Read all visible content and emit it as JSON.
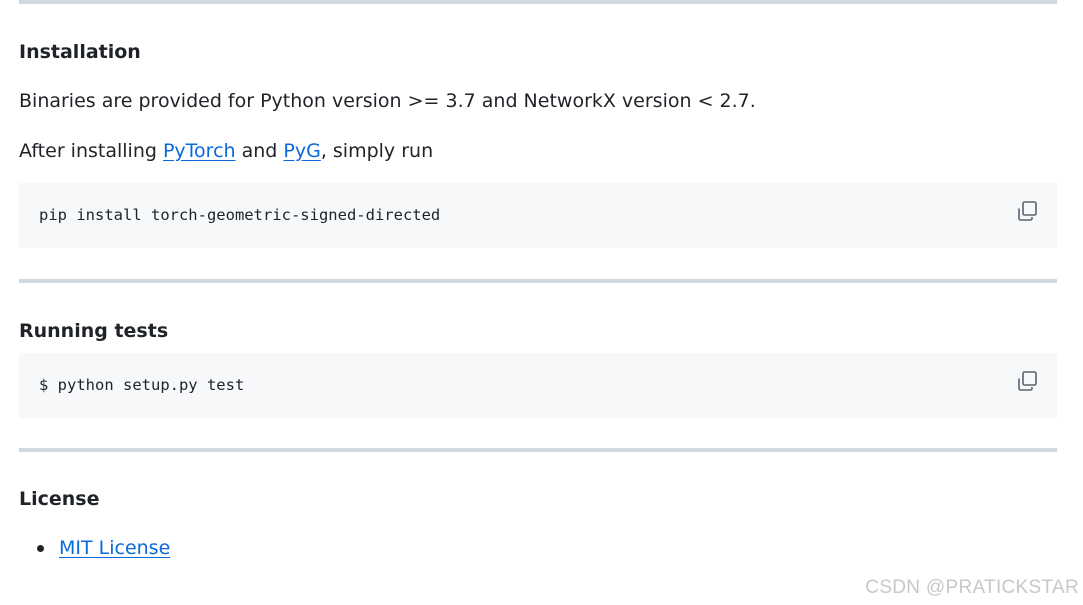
{
  "installation": {
    "heading": "Installation",
    "binaries_text": "Binaries are provided for Python version >= 3.7 and NetworkX version < 2.7.",
    "after_prefix": "After installing ",
    "pytorch_link": "PyTorch",
    "and_text": " and ",
    "pyg_link": "PyG",
    "after_suffix": ", simply run",
    "command": "pip install torch-geometric-signed-directed",
    "copy_icon": "copy-icon"
  },
  "running_tests": {
    "heading": "Running tests",
    "command": "$ python setup.py test",
    "copy_icon": "copy-icon"
  },
  "license": {
    "heading": "License",
    "items": [
      {
        "label": "MIT License"
      }
    ]
  },
  "watermark": "CSDN @PRATICKSTAR",
  "colors": {
    "link": "#0969da",
    "text": "#1f2328",
    "rule": "#d1d9e0",
    "code_bg": "#f6f8fa"
  }
}
